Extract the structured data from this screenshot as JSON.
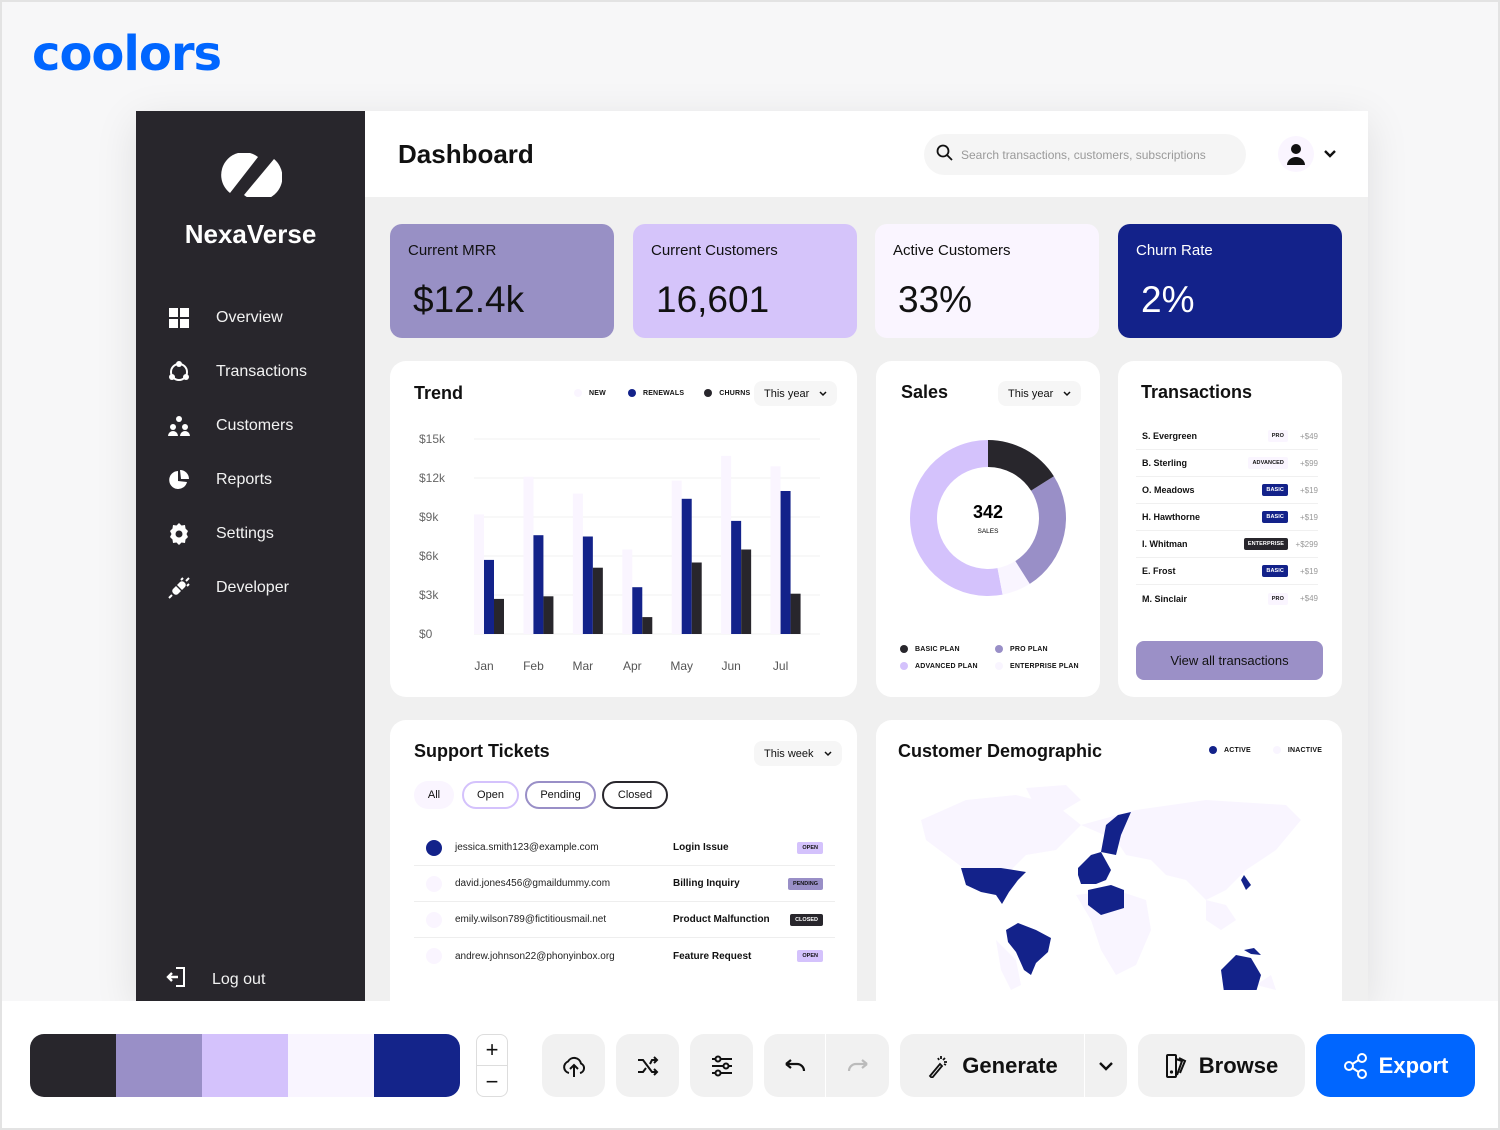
{
  "brand": "coolors",
  "app": {
    "name": "NexaVerse",
    "page_title": "Dashboard"
  },
  "sidebar": {
    "items": [
      {
        "label": "Overview",
        "icon": "grid-icon"
      },
      {
        "label": "Transactions",
        "icon": "cycle-icon"
      },
      {
        "label": "Customers",
        "icon": "users-icon"
      },
      {
        "label": "Reports",
        "icon": "pie-chart-icon"
      },
      {
        "label": "Settings",
        "icon": "gear-icon"
      },
      {
        "label": "Developer",
        "icon": "plug-icon"
      }
    ],
    "logout_label": "Log out"
  },
  "header": {
    "search_placeholder": "Search transactions, customers, subscriptions",
    "search_value": ""
  },
  "kpis": [
    {
      "label": "Current MRR",
      "value": "$12.4k",
      "bg": "#9890c5",
      "fg": "#111111"
    },
    {
      "label": "Current Customers",
      "value": "16,601",
      "bg": "#d5c4fa",
      "fg": "#111111"
    },
    {
      "label": "Active Customers",
      "value": "33%",
      "bg": "#faf5ff",
      "fg": "#111111"
    },
    {
      "label": "Churn Rate",
      "value": "2%",
      "bg": "#13228a",
      "fg": "#ffffff"
    }
  ],
  "trend": {
    "title": "Trend",
    "period": "This year",
    "legend": [
      "NEW",
      "RENEWALS",
      "CHURNS"
    ]
  },
  "sales": {
    "title": "Sales",
    "period": "This year",
    "total": "342",
    "total_label": "SALES",
    "legend": [
      "BASIC PLAN",
      "PRO PLAN",
      "ADVANCED PLAN",
      "ENTERPRISE PLAN"
    ]
  },
  "transactions": {
    "title": "Transactions",
    "rows": [
      {
        "name": "S. Evergreen",
        "plan": "PRO",
        "amount": "+$49"
      },
      {
        "name": "B. Sterling",
        "plan": "ADVANCED",
        "amount": "+$99"
      },
      {
        "name": "O. Meadows",
        "plan": "BASIC",
        "amount": "+$19"
      },
      {
        "name": "H. Hawthorne",
        "plan": "BASIC",
        "amount": "+$19"
      },
      {
        "name": "I. Whitman",
        "plan": "ENTERPRISE",
        "amount": "+$299"
      },
      {
        "name": "E. Frost",
        "plan": "BASIC",
        "amount": "+$19"
      },
      {
        "name": "M. Sinclair",
        "plan": "PRO",
        "amount": "+$49"
      }
    ],
    "view_all_label": "View all transactions"
  },
  "support": {
    "title": "Support Tickets",
    "period": "This week",
    "filters": [
      "All",
      "Open",
      "Pending",
      "Closed"
    ],
    "tickets": [
      {
        "email": "jessica.smith123@example.com",
        "issue": "Login Issue",
        "status": "OPEN",
        "dot": "#13228a"
      },
      {
        "email": "david.jones456@gmaildummy.com",
        "issue": "Billing Inquiry",
        "status": "PENDING",
        "dot": "#faf5ff"
      },
      {
        "email": "emily.wilson789@fictitiousmail.net",
        "issue": "Product Malfunction",
        "status": "CLOSED",
        "dot": "#faf5ff"
      },
      {
        "email": "andrew.johnson22@phonyinbox.org",
        "issue": "Feature Request",
        "status": "OPEN",
        "dot": "#faf5ff"
      }
    ]
  },
  "demographic": {
    "title": "Customer Demographic",
    "legend": [
      "ACTIVE",
      "INACTIVE"
    ],
    "active_regions": [
      "United States",
      "Colombia",
      "Venezuela",
      "Peru",
      "Brazil",
      "Western Europe",
      "Scandinavia",
      "North Africa",
      "Japan",
      "Australia",
      "Papua New Guinea"
    ]
  },
  "palette": {
    "colors": [
      "#28262c",
      "#998fc7",
      "#d4c2fc",
      "#f9f5ff",
      "#14248a"
    ]
  },
  "toolbar": {
    "generate_label": "Generate",
    "browse_label": "Browse",
    "export_label": "Export",
    "accent": "#0066ff"
  },
  "chart_data": [
    {
      "type": "bar",
      "title": "Trend",
      "categories": [
        "Jan",
        "Feb",
        "Mar",
        "Apr",
        "May",
        "Jun",
        "Jul"
      ],
      "series": [
        {
          "name": "NEW",
          "color": "#faf5ff",
          "values": [
            9.2,
            12.1,
            10.8,
            6.5,
            11.8,
            13.7,
            12.9
          ]
        },
        {
          "name": "RENEWALS",
          "color": "#13228a",
          "values": [
            5.7,
            7.6,
            7.5,
            3.6,
            10.4,
            8.7,
            11.0
          ]
        },
        {
          "name": "CHURNS",
          "color": "#28262c",
          "values": [
            2.7,
            2.9,
            5.1,
            1.3,
            5.5,
            6.5,
            3.1
          ]
        }
      ],
      "yticks": [
        "$0",
        "$3k",
        "$6k",
        "$9k",
        "$12k",
        "$15k"
      ],
      "ylim": [
        0,
        15
      ],
      "ylabel_units": "$k",
      "grid": true,
      "legend": "top-right"
    },
    {
      "type": "pie",
      "title": "Sales",
      "donut": true,
      "center_value": "342",
      "center_label": "SALES",
      "slices": [
        {
          "name": "BASIC PLAN",
          "value": 16,
          "color": "#28262c"
        },
        {
          "name": "PRO PLAN",
          "value": 25,
          "color": "#998fc7"
        },
        {
          "name": "ENTERPRISE PLAN",
          "value": 6,
          "color": "#f9f5ff"
        },
        {
          "name": "ADVANCED PLAN",
          "value": 53,
          "color": "#d4c2fc"
        }
      ],
      "legend": "bottom"
    }
  ]
}
